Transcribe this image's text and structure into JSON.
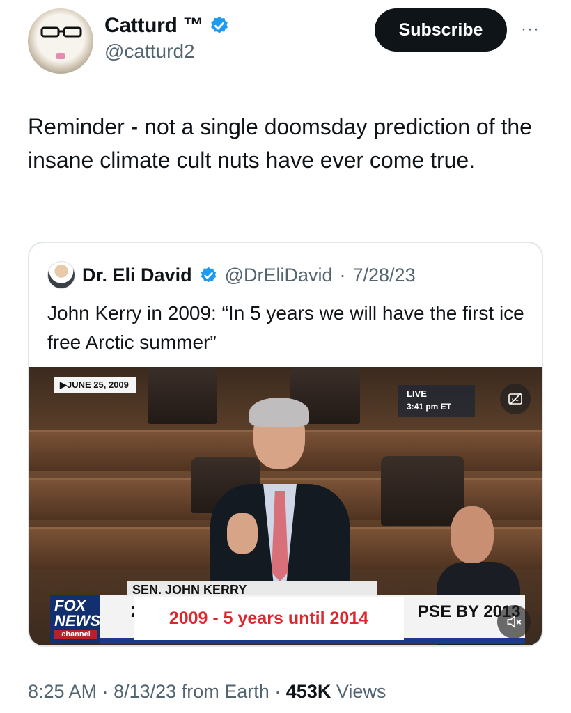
{
  "author": {
    "display_name": "Catturd ™",
    "handle": "@catturd2",
    "verified": true
  },
  "subscribe_label": "Subscribe",
  "more_icon": "···",
  "tweet_text": "Reminder - not a single doomsday prediction of the insane climate cult nuts have ever come true.",
  "quote": {
    "display_name": "Dr. Eli David",
    "handle": "@DrEliDavid",
    "separator": "·",
    "date": "7/28/23",
    "text": "John Kerry in 2009: “In 5 years we will have the first ice free Arctic summer”"
  },
  "video": {
    "date_chip": "▶JUNE 25, 2009",
    "live_label": "LIVE",
    "live_time": "3:41 pm ET",
    "lower_third_name": "SEN. JOHN KERRY",
    "ticker_left": "2009",
    "ticker_right": "PSE BY 2013",
    "overlay_caption": "2009 - 5 years until 2014",
    "network_logo_top": "FOX",
    "network_logo_mid": "NEWS",
    "network_logo_bottom": "channel"
  },
  "meta": {
    "time": "8:25 AM",
    "date": "8/13/23",
    "source": "from Earth",
    "views_count": "453K",
    "views_label": "Views",
    "sep": "·"
  },
  "colors": {
    "text_primary": "#0f1419",
    "text_secondary": "#536471",
    "verified_blue": "#1d9bf0",
    "subscribe_bg": "#0f1419",
    "caption_red": "#e0262d"
  }
}
